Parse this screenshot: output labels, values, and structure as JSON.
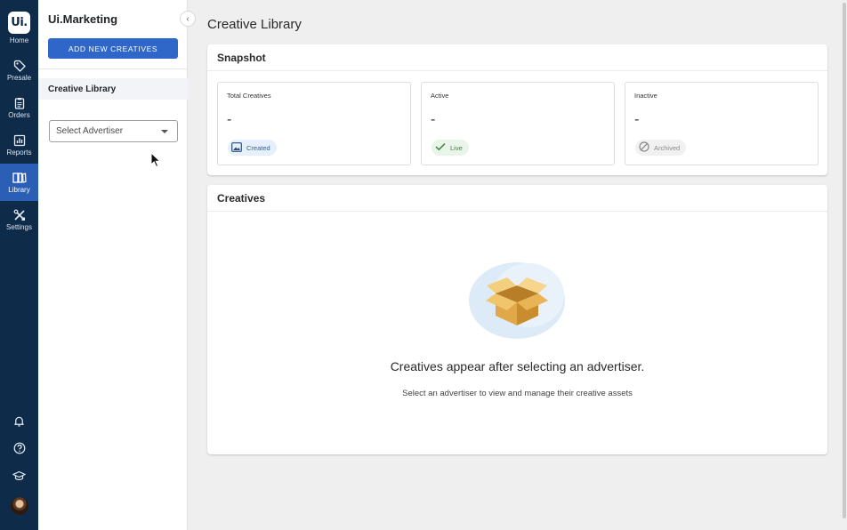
{
  "rail": {
    "logo_text": "Ui.",
    "items": [
      {
        "label": "Home",
        "icon": "home-logo"
      },
      {
        "label": "Presale",
        "icon": "tag-icon"
      },
      {
        "label": "Orders",
        "icon": "clipboard-icon"
      },
      {
        "label": "Reports",
        "icon": "chart-icon"
      },
      {
        "label": "Library",
        "icon": "library-icon",
        "active": true
      },
      {
        "label": "Settings",
        "icon": "tools-icon"
      }
    ],
    "bottom": [
      "bell-icon",
      "help-icon",
      "graduation-cap-icon",
      "avatar"
    ]
  },
  "sidebar": {
    "title": "Ui.Marketing",
    "add_button": "ADD NEW CREATIVES",
    "nav_item": "Creative Library",
    "select_placeholder": "Select Advertiser",
    "collapse_glyph": "‹"
  },
  "main": {
    "page_title": "Creative Library",
    "snapshot": {
      "title": "Snapshot",
      "cards": [
        {
          "title": "Total Creatives",
          "value": "-",
          "chip": "Created",
          "chip_icon": "image-icon"
        },
        {
          "title": "Active",
          "value": "-",
          "chip": "Live",
          "chip_icon": "check-icon"
        },
        {
          "title": "Inactive",
          "value": "-",
          "chip": "Archived",
          "chip_icon": "ban-icon"
        }
      ]
    },
    "creatives": {
      "title": "Creatives",
      "empty_title": "Creatives appear after selecting an advertiser.",
      "empty_subtitle": "Select an advertiser to view and manage their creative assets",
      "illustration": "open-box-icon"
    }
  },
  "colors": {
    "rail_bg": "#0f2b4a",
    "rail_active": "#2a5fb5",
    "primary_button": "#2f67c9",
    "page_bg": "#efefef"
  }
}
